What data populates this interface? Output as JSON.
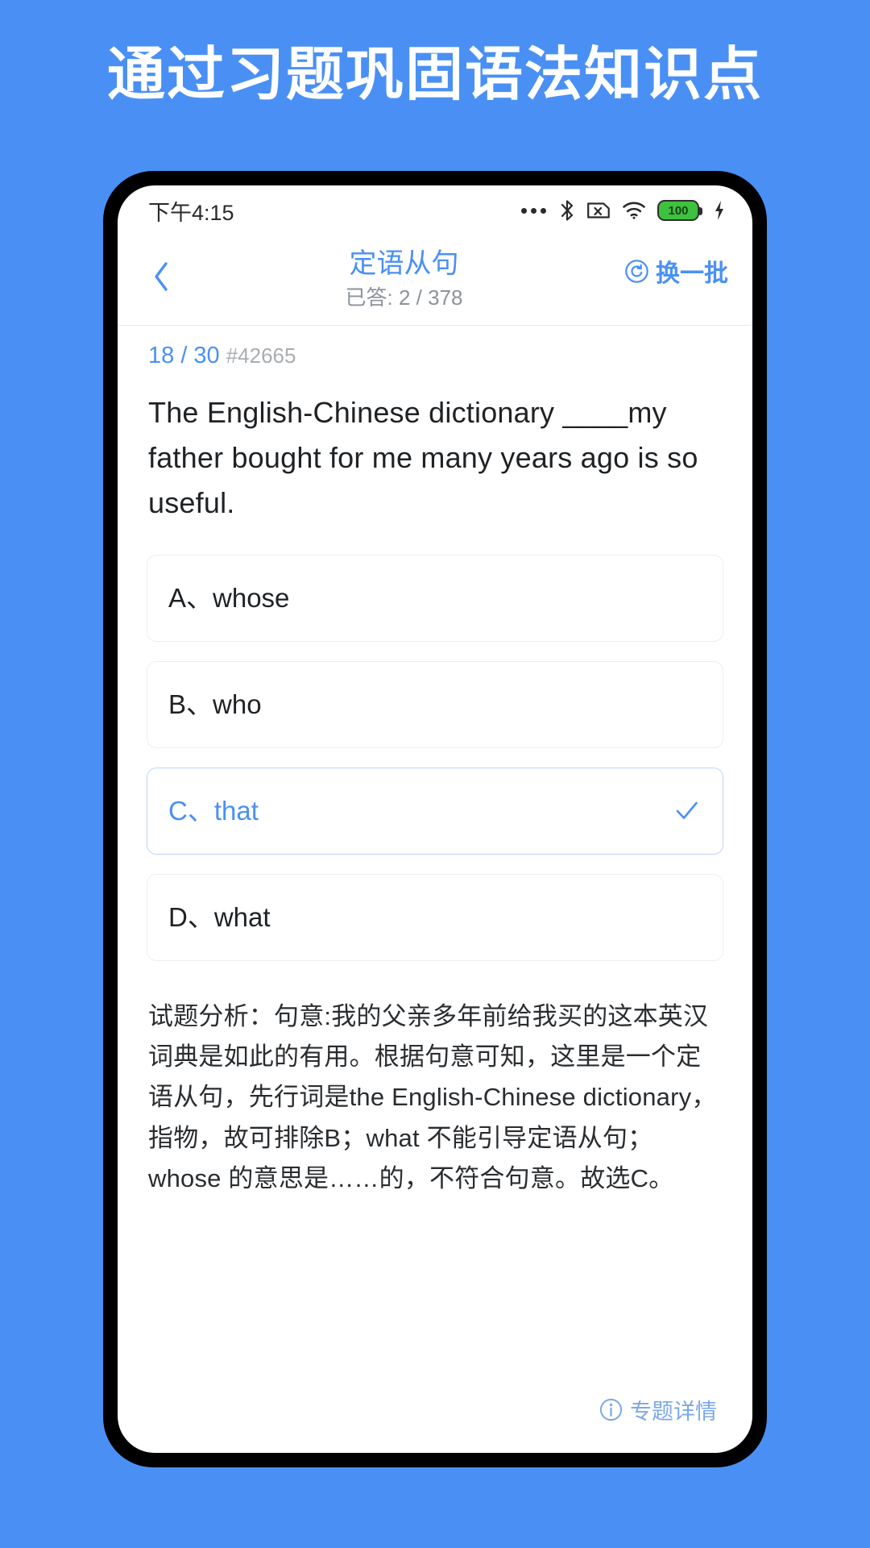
{
  "promo": {
    "headline": "通过习题巩固语法知识点",
    "background_color": "#4a90f4",
    "text_color": "#ffffff"
  },
  "status_bar": {
    "time": "下午4:15",
    "icons": [
      "more-dots-icon",
      "bluetooth-icon",
      "sim-card-disabled-icon",
      "wifi-icon",
      "battery-icon",
      "charging-bolt-icon"
    ],
    "battery_level": "100"
  },
  "header": {
    "back_label": "back-chevron",
    "title": "定语从句",
    "subtitle": "已答: 2 / 378",
    "refresh_label": "换一批",
    "accent_color": "#4a90f4"
  },
  "question": {
    "index_label": "18 / 30",
    "id_label": "#42665",
    "text": "The English-Chinese dictionary ____my father bought for me many years ago is so useful.",
    "options": [
      {
        "label": "A、whose",
        "selected": false
      },
      {
        "label": "B、who",
        "selected": false
      },
      {
        "label": "C、that",
        "selected": true
      },
      {
        "label": "D、what",
        "selected": false
      }
    ],
    "selected_option": "C",
    "analysis": "试题分析：句意:我的父亲多年前给我买的这本英汉词典是如此的有用。根据句意可知，这里是一个定语从句，先行词是the English-Chinese dictionary，指物，故可排除B；what 不能引导定语从句；whose 的意思是……的，不符合句意。故选C。"
  },
  "footer": {
    "detail_label": "专题详情"
  }
}
